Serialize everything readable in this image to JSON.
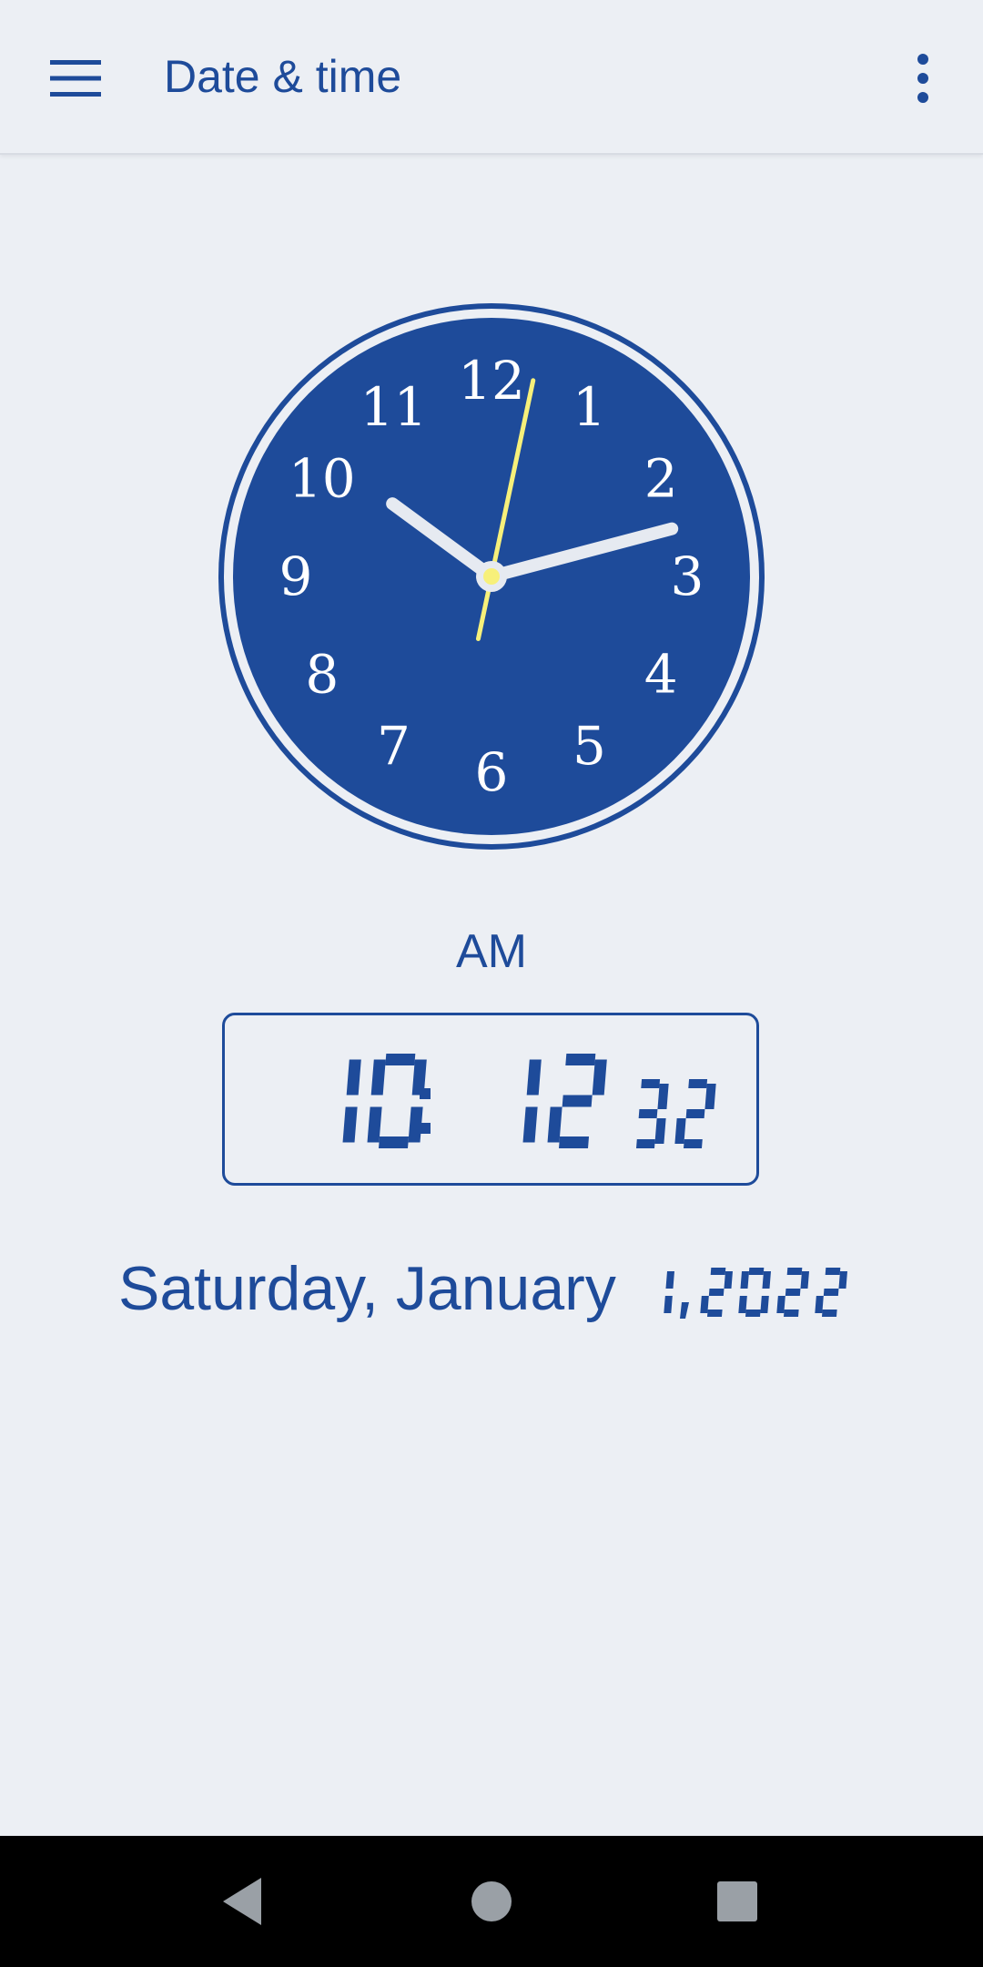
{
  "appbar": {
    "title": "Date & time",
    "menu_icon": "hamburger-menu-icon",
    "overflow_icon": "more-vert-icon"
  },
  "clock": {
    "numerals": [
      "12",
      "1",
      "2",
      "3",
      "4",
      "5",
      "6",
      "7",
      "8",
      "9",
      "10",
      "11"
    ],
    "hour": 10,
    "minute": 12,
    "second": 32,
    "face_color": "#1E4B9A",
    "ring_color": "#1E4B9A",
    "hand_color": "#E6EAF1",
    "second_hand_color": "#F7F07A"
  },
  "digital": {
    "ampm": "AM",
    "hours": "10",
    "minutes": "12",
    "seconds": "32",
    "separator": ":"
  },
  "date": {
    "text": "Saturday, January",
    "day_year": "1, 2022"
  },
  "navbar": {
    "back_icon": "back-triangle-icon",
    "home_icon": "home-circle-icon",
    "recents_icon": "recents-square-icon"
  },
  "colors": {
    "accent": "#1E4B9A",
    "background": "#ECEFF4"
  }
}
